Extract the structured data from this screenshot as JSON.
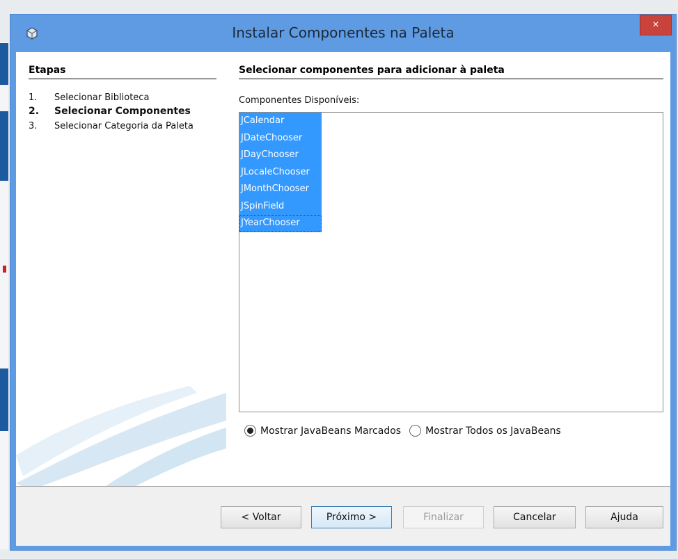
{
  "window": {
    "title": "Instalar Componentes na Paleta",
    "close_label": "×"
  },
  "steps": {
    "title": "Etapas",
    "items": [
      {
        "num": "1.",
        "label": "Selecionar Biblioteca"
      },
      {
        "num": "2.",
        "label": "Selecionar Componentes"
      },
      {
        "num": "3.",
        "label": "Selecionar Categoria da Paleta"
      }
    ]
  },
  "content": {
    "title": "Selecionar componentes para adicionar à paleta",
    "list_label": "Componentes Disponíveis:",
    "components": [
      "JCalendar",
      "JDateChooser",
      "JDayChooser",
      "JLocaleChooser",
      "JMonthChooser",
      "JSpinField",
      "JYearChooser"
    ],
    "radio_marked": "Mostrar JavaBeans Marcados",
    "radio_all": "Mostrar Todos os JavaBeans"
  },
  "buttons": {
    "back": "< Voltar",
    "next": "Próximo >",
    "finish": "Finalizar",
    "cancel": "Cancelar",
    "help": "Ajuda"
  },
  "colors": {
    "titlebar": "#5f9be3",
    "selection": "#3399ff",
    "close": "#c7433b"
  }
}
